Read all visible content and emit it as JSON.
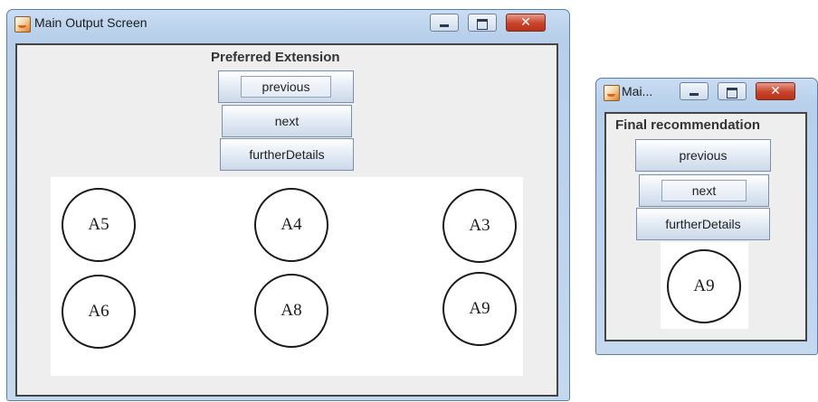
{
  "windows": {
    "main": {
      "title": "Main Output Screen",
      "icon": "java-icon",
      "heading": "Preferred Extension",
      "buttons": {
        "previous": "previous",
        "next": "next",
        "further": "furtherDetails"
      },
      "nodes": [
        "A5",
        "A4",
        "A3",
        "A6",
        "A8",
        "A9"
      ]
    },
    "final": {
      "title": "Mai...",
      "icon": "java-icon",
      "heading": "Final recommendation",
      "buttons": {
        "previous": "previous",
        "next": "next",
        "further": "furtherDetails"
      },
      "nodes": [
        "A9"
      ]
    }
  },
  "colors": {
    "window_frame": "#c4d8ee",
    "content_bg": "#eeeeee",
    "close_button": "#c7432a"
  }
}
